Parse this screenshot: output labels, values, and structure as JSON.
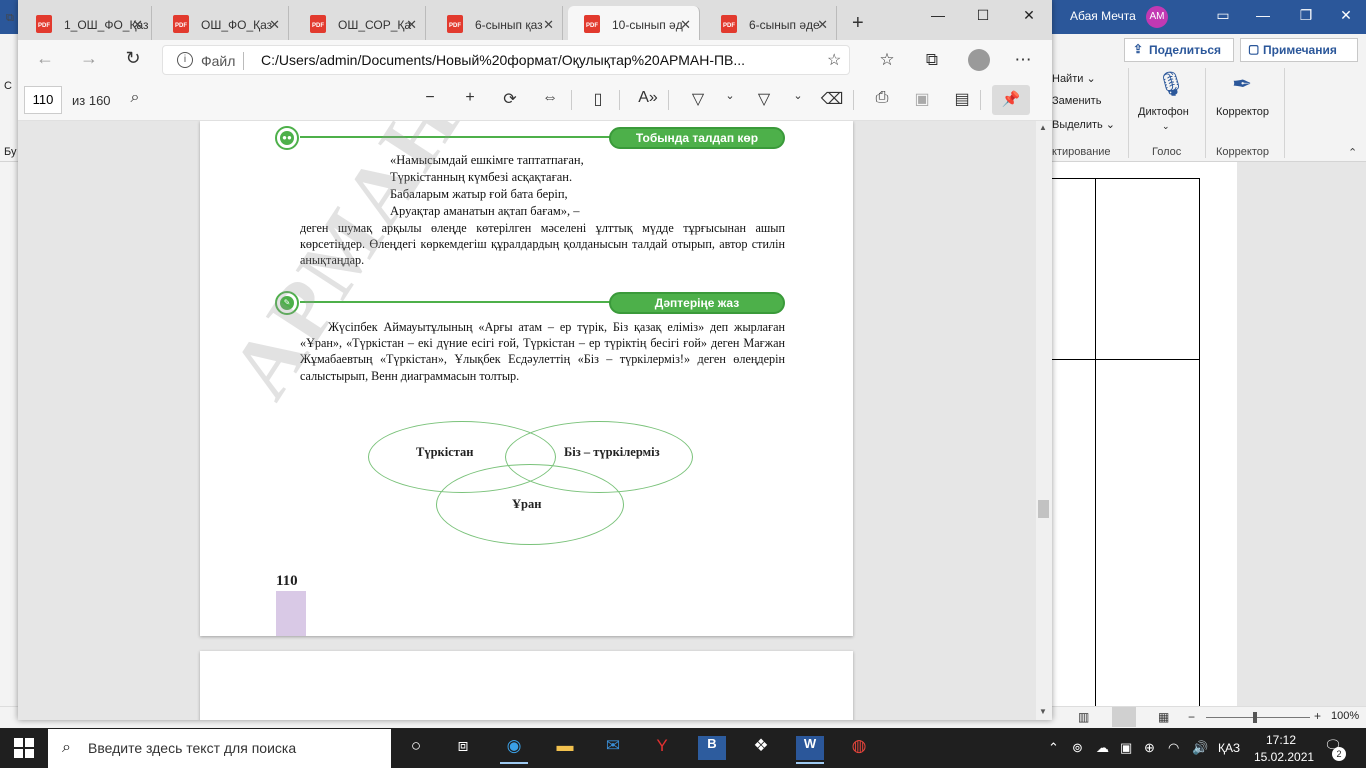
{
  "word": {
    "user_name": "Абая Мечта",
    "user_initials": "AM",
    "share_label": "Поделиться",
    "notes_label": "Примечания",
    "find_label": "Найти",
    "replace_label": "Заменить",
    "select_label": "Выделить",
    "edit_group": "ктирование",
    "dictate_label": "Диктофон",
    "voice_group": "Голос",
    "editor_label": "Корректор",
    "editor_group": "Корректор",
    "zoom_level": "100%",
    "left_fragment_1": "Бу",
    "left_fragment_2": "С"
  },
  "edge": {
    "tabs": [
      {
        "label": "1_ОШ_ФО_Қаз"
      },
      {
        "label": "ОШ_ФО_Қаз"
      },
      {
        "label": "ОШ_СОР_Қа"
      },
      {
        "label": "6-сынып қаз"
      },
      {
        "label": "10-сынып әд"
      },
      {
        "label": "6-сынып әде"
      }
    ],
    "address_file_label": "Файл",
    "address_url": "C:/Users/admin/Documents/Новый%20формат/Оқулықтар%20АРМАН-ПВ...",
    "pdf_page": "110",
    "pdf_total": "из 160"
  },
  "book": {
    "section1_title": "Тобында талдап көр",
    "poem": [
      "«Намысымдай ешкімге таптатпаған,",
      "Түркістанның күмбезі асқақтаған.",
      "Бабаларым жатыр ғой бата беріп,",
      "Аруақтар аманатын ақтап бағам», –"
    ],
    "para1": "деген шумақ арқылы өлеңде көтерілген мәселені ұлттық мүдде тұрғысынан ашып көрсетіңдер. Өлеңдегі көркемдегіш құралдардың қолданысын талдай отырып, автор стилін анықтаңдар.",
    "section2_title": "Дәптеріңе жаз",
    "para2": "Жүсіпбек Аймауытұлының «Арғы атам – ер түрік, Біз қазақ еліміз» деп жырлаған «Ұран», «Түркістан – екі дүние есігі ғой, Түркістан – ер түріктің бесігі ғой» деген Мағжан Жұмабаевтың «Түркістан», Ұлықбек Есдәулеттің «Біз – түркілерміз!» деген өлеңдерін салыстырып, Венн диаграммасын толтыр.",
    "venn": {
      "left": "Түркістан",
      "right": "Біз – түркілерміз",
      "bottom": "Ұран"
    },
    "page_number": "110",
    "watermark": "АРМАН-ПВ"
  },
  "taskbar": {
    "search_placeholder": "Введите здесь текст для поиска",
    "language": "ҚАЗ",
    "time": "17:12",
    "date": "15.02.2021",
    "notification_count": "2"
  }
}
